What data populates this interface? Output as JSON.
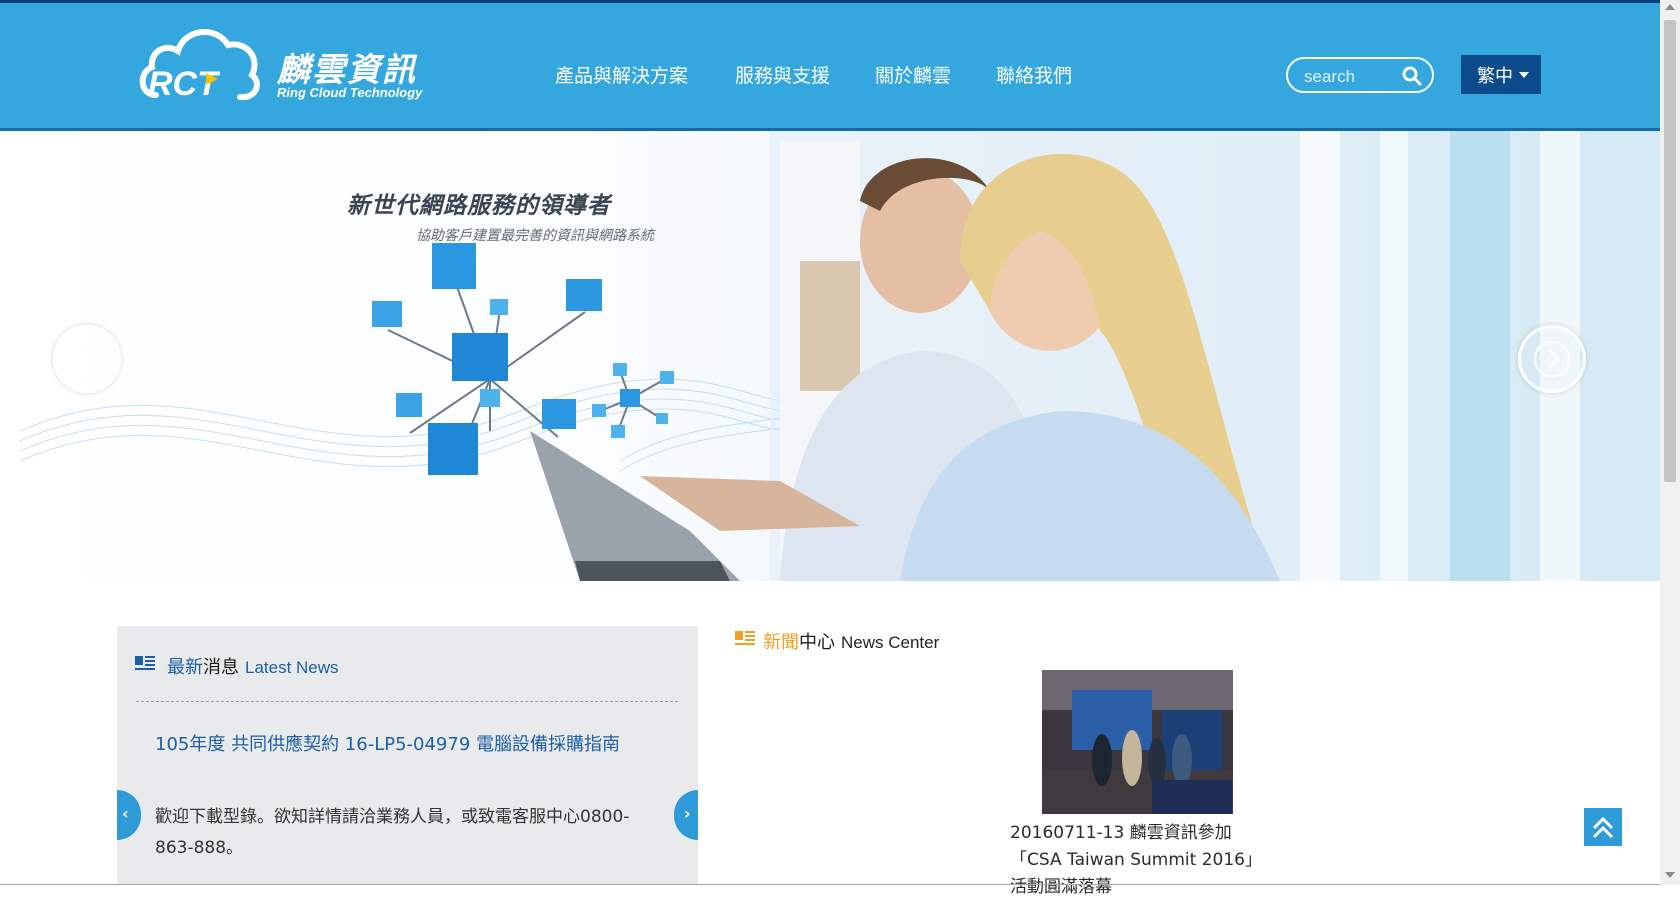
{
  "brand": {
    "logo_mark": "RCT",
    "name_zh": "麟雲資訊",
    "name_en": "Ring Cloud Technology"
  },
  "nav": {
    "items": [
      {
        "label": "產品與解決方案"
      },
      {
        "label": "服務與支援"
      },
      {
        "label": "關於麟雲"
      },
      {
        "label": "聯絡我們"
      }
    ]
  },
  "search": {
    "placeholder": "search",
    "icon": "search-icon"
  },
  "language": {
    "selected": "繁中"
  },
  "banner": {
    "title": "新世代網路服務的領導者",
    "subtitle": "協助客戶建置最完善的資訊與網路系統"
  },
  "latest_news": {
    "title_part1": "最新",
    "title_part2": "消息",
    "title_en": "Latest News",
    "headline": "105年度 共同供應契約 16-LP5-04979 電腦設備採購指南",
    "body": "歡迎下載型錄。欲知詳情請洽業務人員，或致電客服中心0800-863-888。"
  },
  "news_center": {
    "title_part1": "新聞",
    "title_part2": "中心",
    "title_en": "News Center",
    "caption": "20160711-13 麟雲資訊參加「CSA Taiwan Summit 2016」活動圓滿落幕"
  },
  "colors": {
    "header_bg": "#33a7de",
    "lang_bg": "#0b4b8c",
    "accent_blue": "#1c5fa8",
    "accent_orange": "#f0a020",
    "button_blue": "#2e9ad8"
  }
}
